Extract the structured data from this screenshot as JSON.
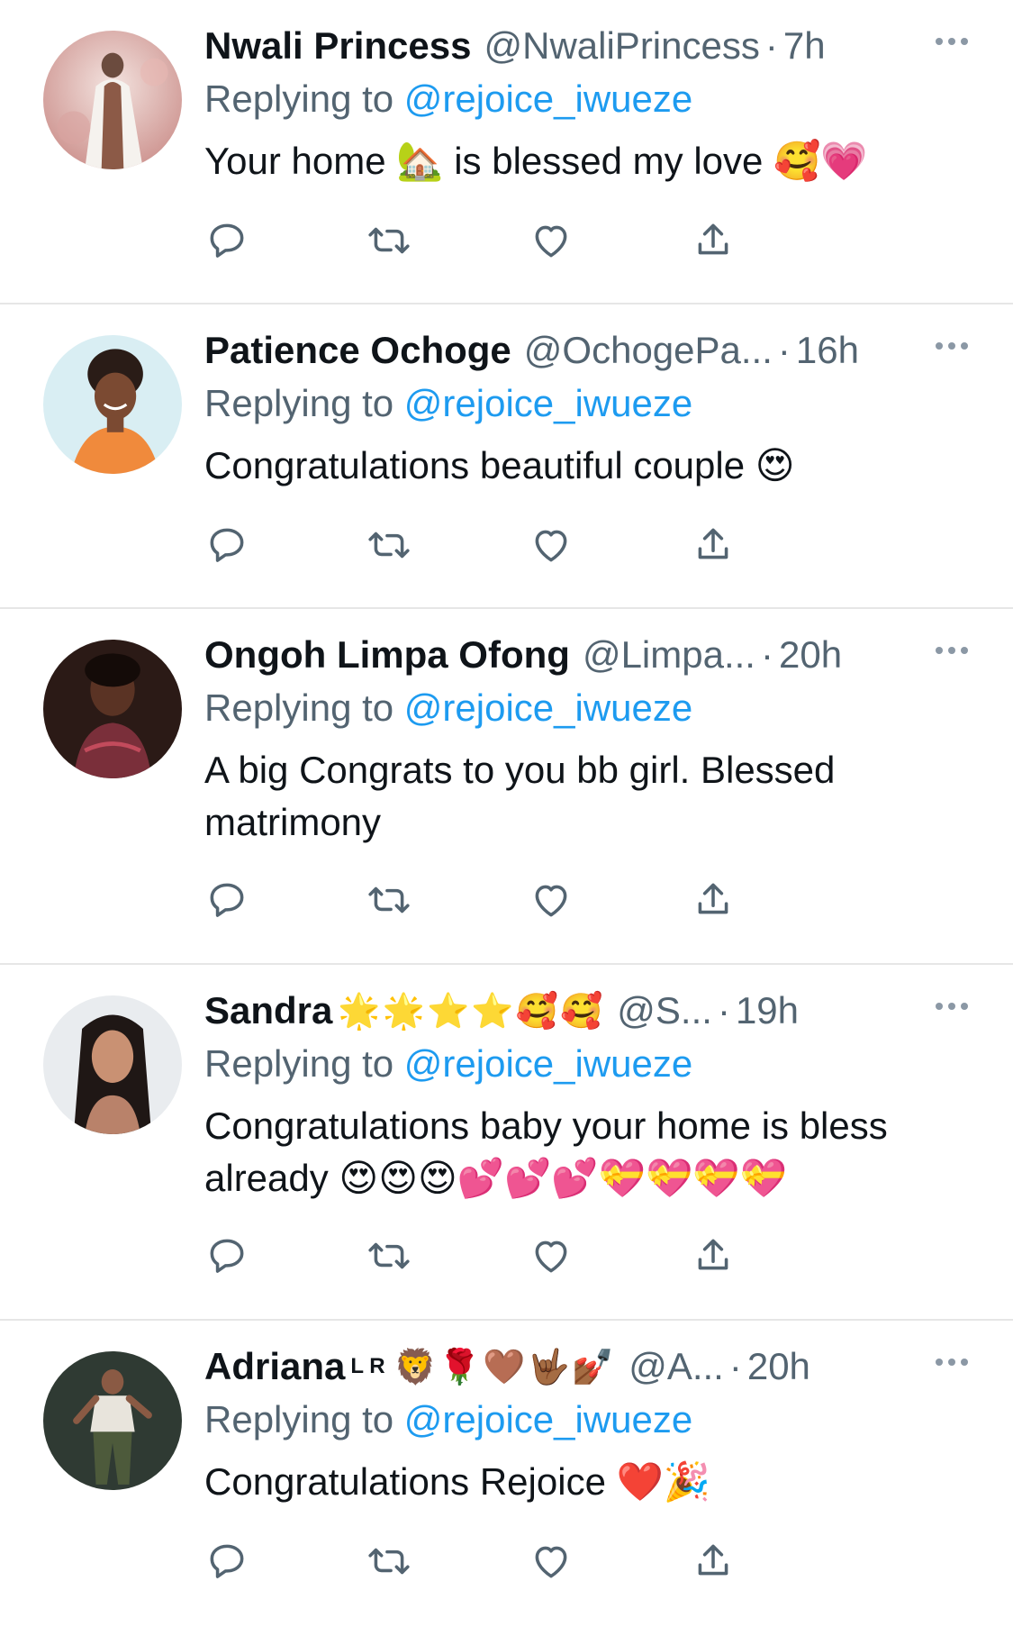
{
  "replies": [
    {
      "name": "Nwali Princess",
      "name_extra": "",
      "name_sup": "",
      "handle": "@NwaliPrincess",
      "separator": "·",
      "time": "7h",
      "replying_prefix": "Replying to",
      "replying_to": "@rejoice_iwueze",
      "text": "Your home 🏡 is blessed my love 🥰💗"
    },
    {
      "name": "Patience Ochoge",
      "name_extra": "",
      "name_sup": "",
      "handle": "@OchogePa...",
      "separator": "·",
      "time": "16h",
      "replying_prefix": "Replying to",
      "replying_to": "@rejoice_iwueze",
      "text": "Congratulations beautiful couple 😍"
    },
    {
      "name": "Ongoh Limpa Ofong",
      "name_extra": "",
      "name_sup": "",
      "handle": "@Limpa...",
      "separator": "·",
      "time": "20h",
      "replying_prefix": "Replying to",
      "replying_to": "@rejoice_iwueze",
      "text": "A big Congrats to you bb girl. Blessed matrimony"
    },
    {
      "name": "Sandra",
      "name_extra": "🌟🌟⭐⭐🥰🥰",
      "name_sup": "",
      "handle": "@S...",
      "separator": "·",
      "time": "19h",
      "replying_prefix": "Replying to",
      "replying_to": "@rejoice_iwueze",
      "text": "Congratulations baby your home is bless already 😍😍😍💕💕💕💝💝💝💝"
    },
    {
      "name": "Adriana",
      "name_extra": "🦁🌹🤎🤟🏾💅🏾",
      "name_sup": "L R",
      "handle": "@A...",
      "separator": "·",
      "time": "20h",
      "replying_prefix": "Replying to",
      "replying_to": "@rejoice_iwueze",
      "text": "Congratulations Rejoice ❤️🎉"
    }
  ],
  "icons": {
    "reply": "reply-icon",
    "retweet": "retweet-icon",
    "like": "like-icon",
    "share": "share-icon",
    "more": "more-icon"
  },
  "colors": {
    "link": "#1d9bf0",
    "secondary": "#536471",
    "divider": "#e6e6e6",
    "icon": "#536471"
  }
}
